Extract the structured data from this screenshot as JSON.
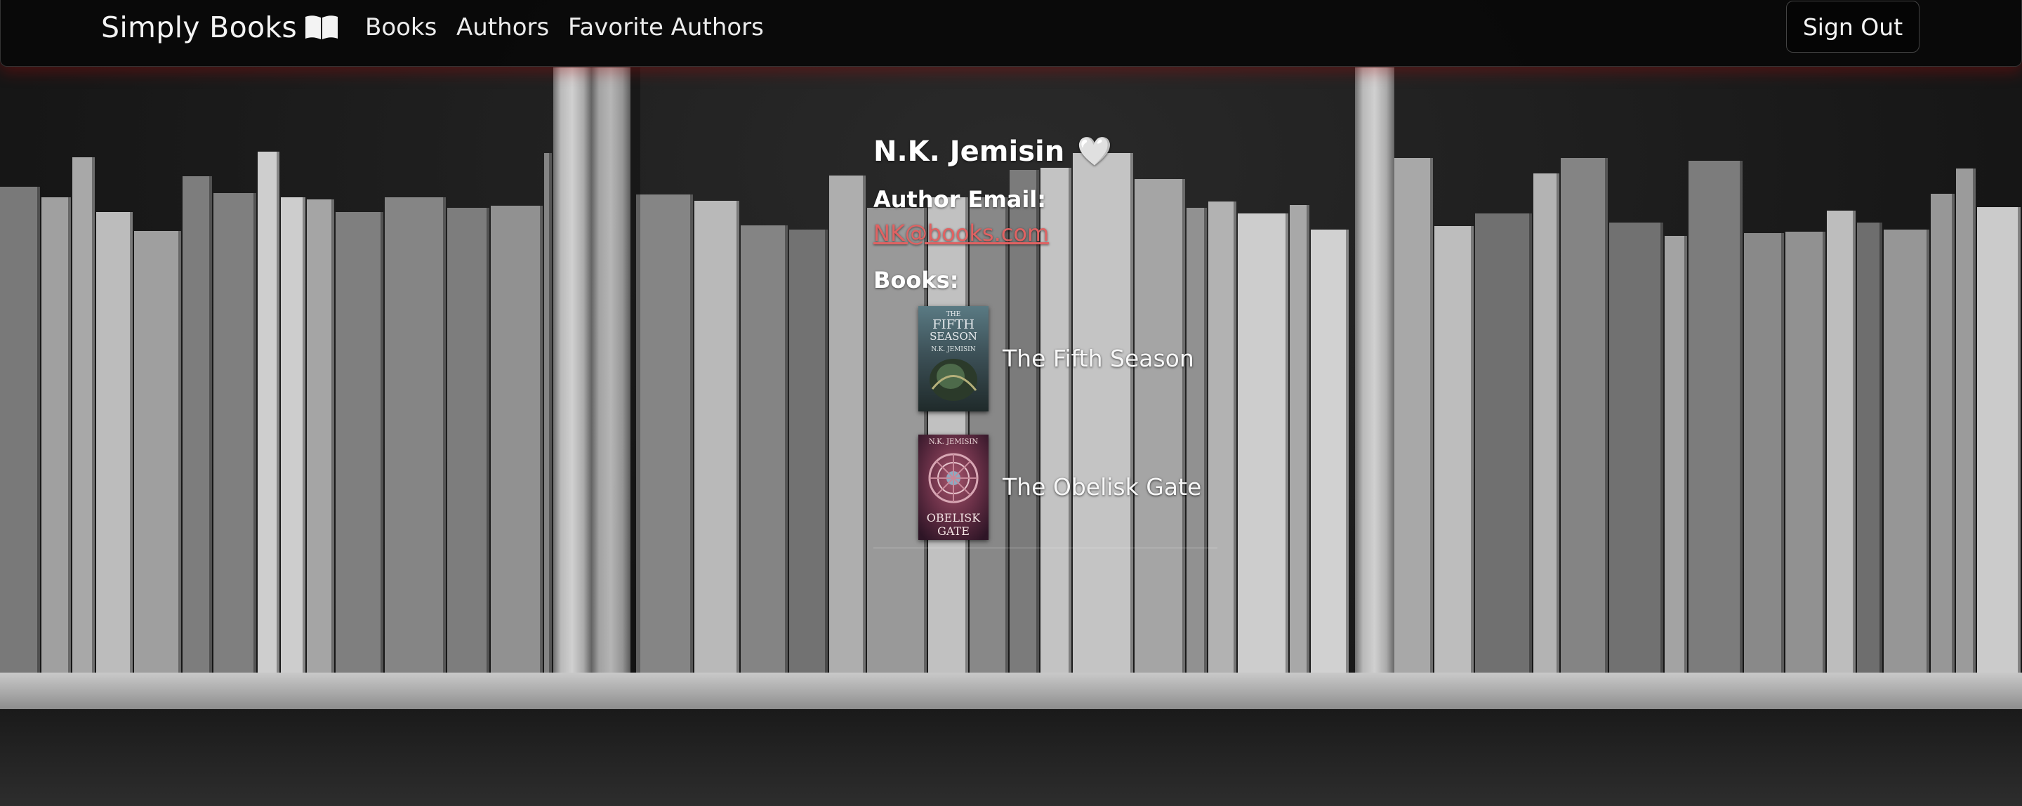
{
  "navbar": {
    "brand": "Simply Books",
    "brand_icon": "open-book-icon",
    "links": [
      "Books",
      "Authors",
      "Favorite Authors"
    ],
    "sign_out": "Sign Out"
  },
  "author": {
    "name": "N.K. Jemisin",
    "favorite_icon": "white-heart-icon",
    "email_label": "Author Email:",
    "email": "NK@books.com",
    "books_label": "Books:",
    "books": [
      {
        "title": "The Fifth Season",
        "cover_text": [
          "THE",
          "FIFTH",
          "SEASON",
          "N.K. JEMISIN"
        ]
      },
      {
        "title": "The Obelisk Gate",
        "cover_text": [
          "N.K. JEMISIN",
          "OBELISK",
          "GATE"
        ]
      }
    ]
  },
  "colors": {
    "navbar_bg": "#080808",
    "navbar_glow": "#a00a0a",
    "email_link": "#e06262",
    "text": "#ffffff"
  }
}
